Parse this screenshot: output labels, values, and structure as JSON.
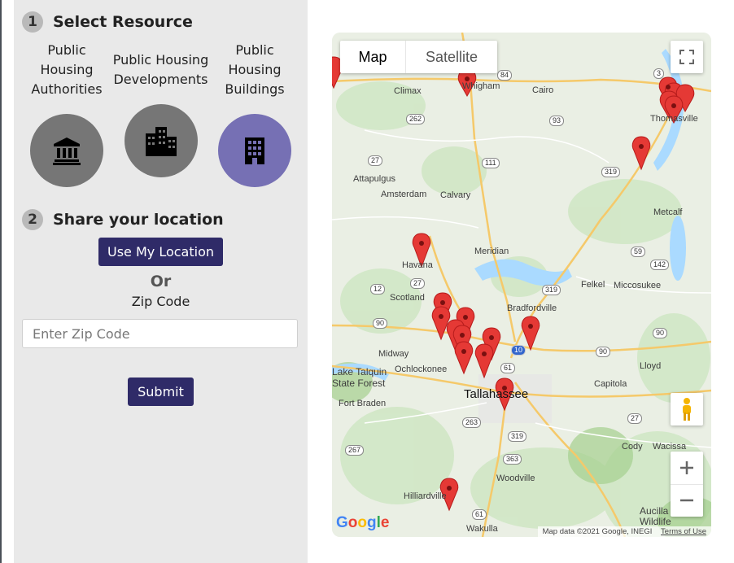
{
  "steps": {
    "step1_number": "1",
    "step1_title": "Select Resource",
    "step2_number": "2",
    "step2_title": "Share your location"
  },
  "resources": [
    {
      "label": "Public Housing Authorities",
      "icon": "bank-icon",
      "selected": false
    },
    {
      "label": "Public Housing Developments",
      "icon": "city-buildings-icon",
      "selected": false
    },
    {
      "label": "Public Housing Buildings",
      "icon": "building-icon",
      "selected": true
    }
  ],
  "location": {
    "use_my_location": "Use My Location",
    "or": "Or",
    "zip_label": "Zip Code",
    "zip_placeholder": "Enter Zip Code",
    "submit": "Submit"
  },
  "map": {
    "type_map": "Map",
    "type_satellite": "Satellite",
    "attribution": "Map data ©2021 Google, INEGI",
    "terms": "Terms of Use",
    "google_logo": "Google",
    "places": [
      "Whigham",
      "Climax",
      "Cairo",
      "Thomasville",
      "Attapulgus",
      "Amsterdam",
      "Calvary",
      "Metcalf",
      "Havana",
      "Meridian",
      "Felkel",
      "Miccosukee",
      "Scotland",
      "Bradfordville",
      "Midway",
      "Ochlockonee",
      "Lake Talquin State Forest",
      "Lloyd",
      "Capitola",
      "Tallahassee",
      "Fort Braden",
      "Cody",
      "Wacissa",
      "Woodville",
      "Hilliardville",
      "Wakulla",
      "Aucilla Wildlife"
    ],
    "roads": [
      "84",
      "262",
      "93",
      "27",
      "111",
      "319",
      "3",
      "59",
      "142",
      "12",
      "27",
      "319",
      "90",
      "90",
      "10",
      "90",
      "61",
      "263",
      "319",
      "267",
      "363",
      "27",
      "61"
    ],
    "marker_color": "#e53935"
  },
  "colors": {
    "panel_bg": "#e9e9e9",
    "button_bg": "#2f2b68",
    "icon_circle": "#767676",
    "icon_circle_selected": "#7670b4"
  }
}
